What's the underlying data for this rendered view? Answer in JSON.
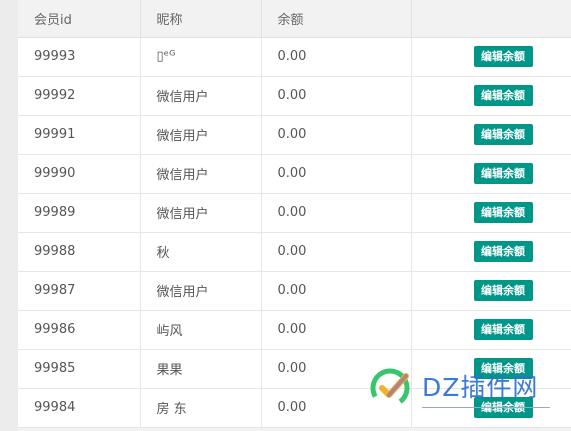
{
  "table": {
    "headers": {
      "id": "会员id",
      "nickname": "昵称",
      "balance": "余额",
      "actions": ""
    },
    "rows": [
      {
        "id": "99993",
        "nickname": "▯ᵉᴳ",
        "balance": "0.00",
        "action": "编辑余额"
      },
      {
        "id": "99992",
        "nickname": "微信用户",
        "balance": "0.00",
        "action": "编辑余额"
      },
      {
        "id": "99991",
        "nickname": "微信用户",
        "balance": "0.00",
        "action": "编辑余额"
      },
      {
        "id": "99990",
        "nickname": "微信用户",
        "balance": "0.00",
        "action": "编辑余额"
      },
      {
        "id": "99989",
        "nickname": "微信用户",
        "balance": "0.00",
        "action": "编辑余额"
      },
      {
        "id": "99988",
        "nickname": "秋",
        "balance": "0.00",
        "action": "编辑余额"
      },
      {
        "id": "99987",
        "nickname": "微信用户",
        "balance": "0.00",
        "action": "编辑余额"
      },
      {
        "id": "99986",
        "nickname": "屿风",
        "balance": "0.00",
        "action": "编辑余额"
      },
      {
        "id": "99985",
        "nickname": "果果",
        "balance": "0.00",
        "action": "编辑余额"
      },
      {
        "id": "99984",
        "nickname": "房 东",
        "balance": "0.00",
        "action": "编辑余额"
      }
    ]
  },
  "watermark": {
    "text": "DZ插件网",
    "icon": "checkmark-logo-icon",
    "colors": {
      "icon_left": "#37c56e",
      "icon_right": "#f0b42a",
      "text": "#2d6fd1"
    }
  },
  "colors": {
    "button_bg": "#009688",
    "header_bg": "#f2f2f2",
    "border": "#e6e6e6"
  }
}
